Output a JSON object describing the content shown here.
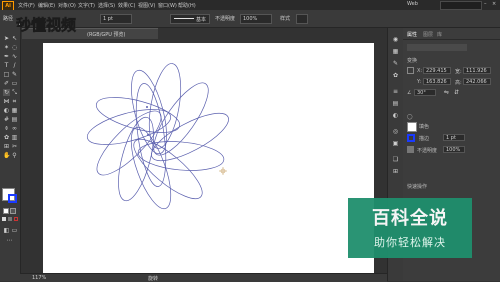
{
  "menu": {
    "app_logo": "Ai",
    "items": [
      "文件(F)",
      "编辑(E)",
      "对象(O)",
      "文字(T)",
      "选择(S)",
      "效果(C)",
      "视图(V)",
      "窗口(W)",
      "帮助(H)"
    ],
    "workspace": "Web"
  },
  "controlbar": {
    "left_label": "路径",
    "stroke_label": "描边",
    "stroke_value": "1 pt",
    "brush_label": "基本",
    "opacity_label": "不透明度",
    "opacity_value": "100%",
    "style_label": "样式"
  },
  "doctab": {
    "title": "(RGB/GPU 预览)"
  },
  "logo": {
    "text": "秒懂视频"
  },
  "panels": {
    "tabs": [
      "属性",
      "图层",
      "库"
    ],
    "transform_label": "变换",
    "x_label": "X:",
    "x_value": "229.415",
    "y_label": "Y:",
    "y_value": "163.826",
    "w_label": "宽:",
    "w_value": "111.926",
    "h_label": "高:",
    "h_value": "242.066",
    "angle_value": "30°",
    "fill_label": "填色",
    "stroke_label": "描边",
    "stroke_value": "1 pt",
    "opacity_label": "不透明度",
    "opacity_value": "100%",
    "quick_actions": "快速操作"
  },
  "status": {
    "zoom": "117%",
    "tool": "旋转"
  },
  "watermark": {
    "line1": "百科全说",
    "line2": "助你轻松解决"
  },
  "colors": {
    "accent": "#ff9a00",
    "path_stroke": "#5a5fae",
    "watermark_bg": "#1f8f6d"
  }
}
